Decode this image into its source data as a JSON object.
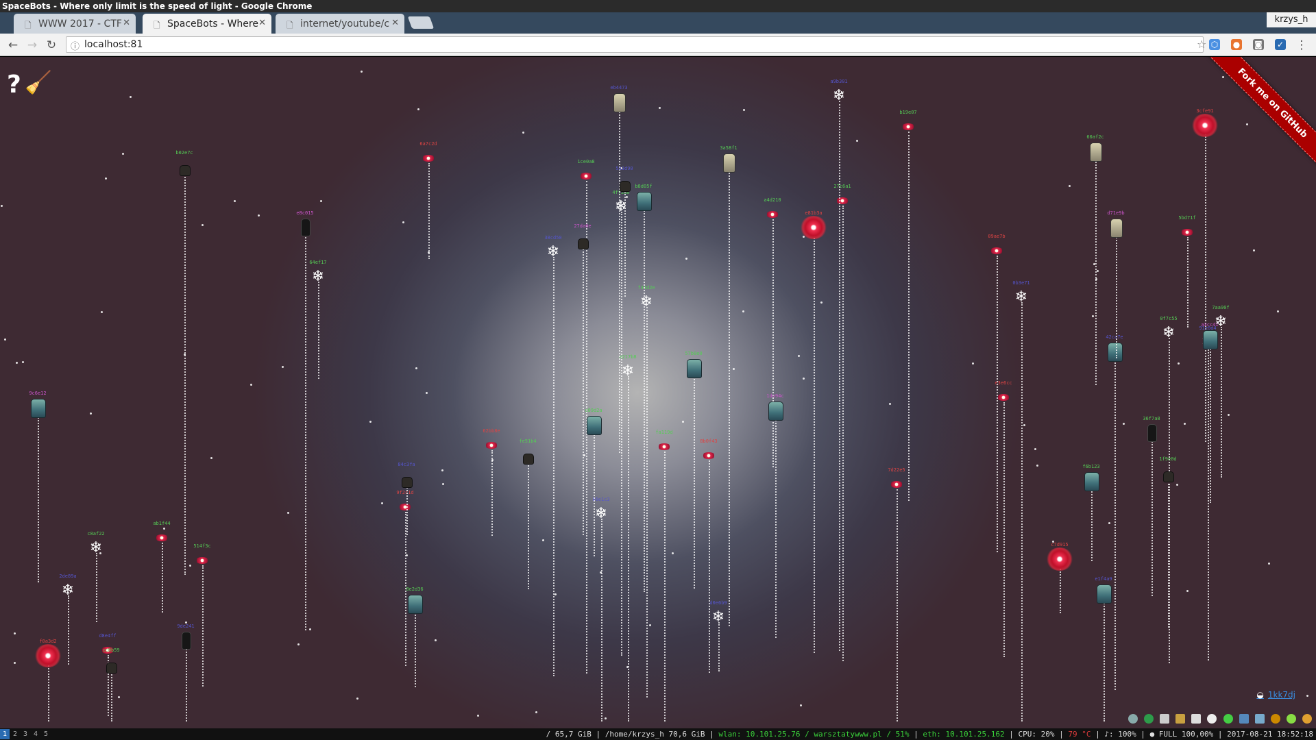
{
  "window": {
    "title": "SpaceBots - Where only limit is the speed of light - Google Chrome"
  },
  "tabs": [
    {
      "label": "WWW 2017 - CTF",
      "active": false
    },
    {
      "label": "SpaceBots - Where",
      "active": true
    },
    {
      "label": "internet/youtube/c",
      "active": false
    }
  ],
  "profile": {
    "name": "krzys_h"
  },
  "omnibox": {
    "url": "localhost:81"
  },
  "page": {
    "help_glyph": "?",
    "fork_ribbon": "Fork me on GitHub",
    "counter_label": "1kk7dj"
  },
  "statusbar": {
    "workspaces": [
      "1",
      "2",
      "3",
      "4",
      "5"
    ],
    "disk_root": "/ 65,7 GiB",
    "disk_home": "/home/krzys_h 70,6 GiB",
    "wlan": "wlan: 10.101.25.76 / warsztatywww.pl /  51%",
    "eth": "eth: 10.101.25.162",
    "cpu": "CPU: 20%",
    "temp": "79 °C",
    "volume": "♪: 100%",
    "battery": "● FULL 100,00%",
    "datetime": "2017-08-21 18:52:18"
  },
  "colors": {
    "accent_blue": "#2a6bb2",
    "ribbon_red": "#aa0000",
    "status_green": "#3ad03a",
    "status_red": "#e03c3c"
  },
  "icons": {
    "help": "question-mark-icon",
    "broom": "broom-icon",
    "back": "back-arrow-icon",
    "forward": "forward-arrow-icon",
    "reload": "reload-icon",
    "bookmark": "star-icon",
    "info": "info-icon"
  },
  "bots": [
    {
      "kind": "eye",
      "label": "9f2c1d",
      "color": "#d44"
    },
    {
      "kind": "eye",
      "label": "e81b3a",
      "color": "#d44",
      "hit": true
    },
    {
      "kind": "eye",
      "label": "a4d210",
      "color": "#5c5"
    },
    {
      "kind": "eye",
      "label": "3cfe91",
      "color": "#d44",
      "hit": true
    },
    {
      "kind": "eye",
      "label": "b19e07",
      "color": "#5c5"
    },
    {
      "kind": "eye",
      "label": "f0a3d2",
      "color": "#d44",
      "hit": true
    },
    {
      "kind": "eye",
      "label": "62bb8e",
      "color": "#d44"
    },
    {
      "kind": "eye",
      "label": "c7d915",
      "color": "#d44",
      "hit": true
    },
    {
      "kind": "eye",
      "label": "514f3c",
      "color": "#5c5"
    },
    {
      "kind": "eye",
      "label": "09ae7b",
      "color": "#d44"
    },
    {
      "kind": "eye",
      "label": "d8e4ff",
      "color": "#55c"
    },
    {
      "kind": "eye",
      "label": "27c6a1",
      "color": "#5c5"
    },
    {
      "kind": "eye",
      "label": "8b0f43",
      "color": "#d44"
    },
    {
      "kind": "eye",
      "label": "fa119d",
      "color": "#5c5"
    },
    {
      "kind": "eye",
      "label": "1ce0a8",
      "color": "#5c5"
    },
    {
      "kind": "eye",
      "label": "7d22e5",
      "color": "#d44"
    },
    {
      "kind": "eye",
      "label": "e3e6cc",
      "color": "#d44"
    },
    {
      "kind": "eye",
      "label": "5bd71f",
      "color": "#5c5"
    },
    {
      "kind": "eye",
      "label": "ab1f44",
      "color": "#5c5"
    },
    {
      "kind": "eye",
      "label": "6a7c2d",
      "color": "#d44"
    },
    {
      "kind": "flake",
      "label": "d0e6b9",
      "color": "#55c"
    },
    {
      "kind": "flake",
      "label": "4ff2a0",
      "color": "#5c5"
    },
    {
      "kind": "flake",
      "label": "0b3e71",
      "color": "#55c"
    },
    {
      "kind": "flake",
      "label": "c8af22",
      "color": "#5c5"
    },
    {
      "kind": "flake",
      "label": "91e0d4",
      "color": "#55c"
    },
    {
      "kind": "flake",
      "label": "e217b8",
      "color": "#5c5"
    },
    {
      "kind": "flake",
      "label": "38cd50",
      "color": "#55c"
    },
    {
      "kind": "flake",
      "label": "7aa90f",
      "color": "#5c5"
    },
    {
      "kind": "flake",
      "label": "b6e1c3",
      "color": "#55c"
    },
    {
      "kind": "flake",
      "label": "f44d2e",
      "color": "#5c5"
    },
    {
      "kind": "flake",
      "label": "2de89a",
      "color": "#55c"
    },
    {
      "kind": "flake",
      "label": "0f7c55",
      "color": "#5c5"
    },
    {
      "kind": "flake",
      "label": "a9b301",
      "color": "#55c"
    },
    {
      "kind": "flake",
      "label": "64ef17",
      "color": "#5c5"
    },
    {
      "kind": "mech",
      "label": "c09d2a",
      "color": "#5c5"
    },
    {
      "kind": "mech",
      "label": "a3cc41",
      "color": "#c5c"
    },
    {
      "kind": "mech",
      "label": "57b8e0",
      "color": "#5c5"
    },
    {
      "kind": "mech",
      "label": "e1f4a9",
      "color": "#55c"
    },
    {
      "kind": "mech",
      "label": "8e2d36",
      "color": "#5c5"
    },
    {
      "kind": "mech",
      "label": "1da94c",
      "color": "#c5c"
    },
    {
      "kind": "mech",
      "label": "f6b123",
      "color": "#5c5"
    },
    {
      "kind": "mech",
      "label": "42ca7e",
      "color": "#55c"
    },
    {
      "kind": "mech",
      "label": "b8d05f",
      "color": "#5c5"
    },
    {
      "kind": "mech",
      "label": "9c6e12",
      "color": "#c5c"
    },
    {
      "kind": "tower",
      "label": "3a58f1",
      "color": "#5c5"
    },
    {
      "kind": "tower",
      "label": "d71e9b",
      "color": "#c5c"
    },
    {
      "kind": "tower",
      "label": "60af2c",
      "color": "#5c5"
    },
    {
      "kind": "tower",
      "label": "eb4473",
      "color": "#55c"
    },
    {
      "kind": "box",
      "label": "1f9e0d",
      "color": "#5c5"
    },
    {
      "kind": "box",
      "label": "84c3fa",
      "color": "#55c"
    },
    {
      "kind": "box",
      "label": "cc0b59",
      "color": "#5c5"
    },
    {
      "kind": "box",
      "label": "27da6e",
      "color": "#c5c"
    },
    {
      "kind": "box",
      "label": "fe51b4",
      "color": "#5c5"
    },
    {
      "kind": "box",
      "label": "5a3d90",
      "color": "#55c"
    },
    {
      "kind": "box",
      "label": "b02e7c",
      "color": "#5c5"
    },
    {
      "kind": "tall",
      "label": "9de241",
      "color": "#55c"
    },
    {
      "kind": "tall",
      "label": "36f7a8",
      "color": "#5c5"
    },
    {
      "kind": "tall",
      "label": "e8c015",
      "color": "#c5c"
    }
  ]
}
